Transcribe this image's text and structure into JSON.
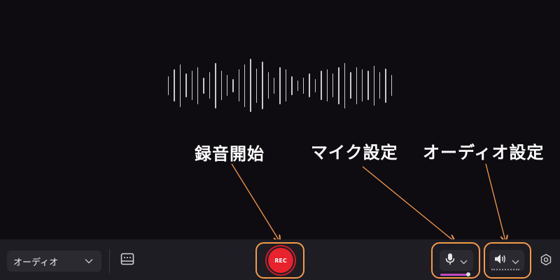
{
  "annotations": {
    "record_start": "録音開始",
    "mic_settings": "マイク設定",
    "audio_settings": "オーディオ設定"
  },
  "toolbar": {
    "source_select": {
      "selected": "オーディオ"
    },
    "record_button_label": "REC",
    "mic_level": 0.95
  },
  "icons": {
    "dropdown": "chevron-down-icon",
    "subtitle": "subtitle-icon",
    "mic": "microphone-icon",
    "speaker": "speaker-icon",
    "settings": "settings-icon"
  },
  "colors": {
    "background": "#0e0c10",
    "toolbar": "#1e1d23",
    "record": "#e8232d",
    "highlight": "#f59a4a",
    "mic_level": "#c04ac4"
  },
  "waveform": {
    "levels": [
      0.35,
      0.6,
      0.8,
      0.45,
      0.55,
      0.7,
      0.3,
      0.5,
      0.85,
      0.55,
      0.4,
      0.25,
      0.6,
      0.8,
      1.0,
      0.65,
      0.9,
      0.5,
      0.3,
      0.7,
      0.6,
      0.35,
      0.2,
      0.3,
      0.45,
      0.25,
      0.55,
      0.6,
      0.45,
      0.7,
      0.85,
      0.5,
      0.7,
      0.6,
      0.55,
      0.75,
      0.5,
      0.65,
      0.4
    ]
  }
}
